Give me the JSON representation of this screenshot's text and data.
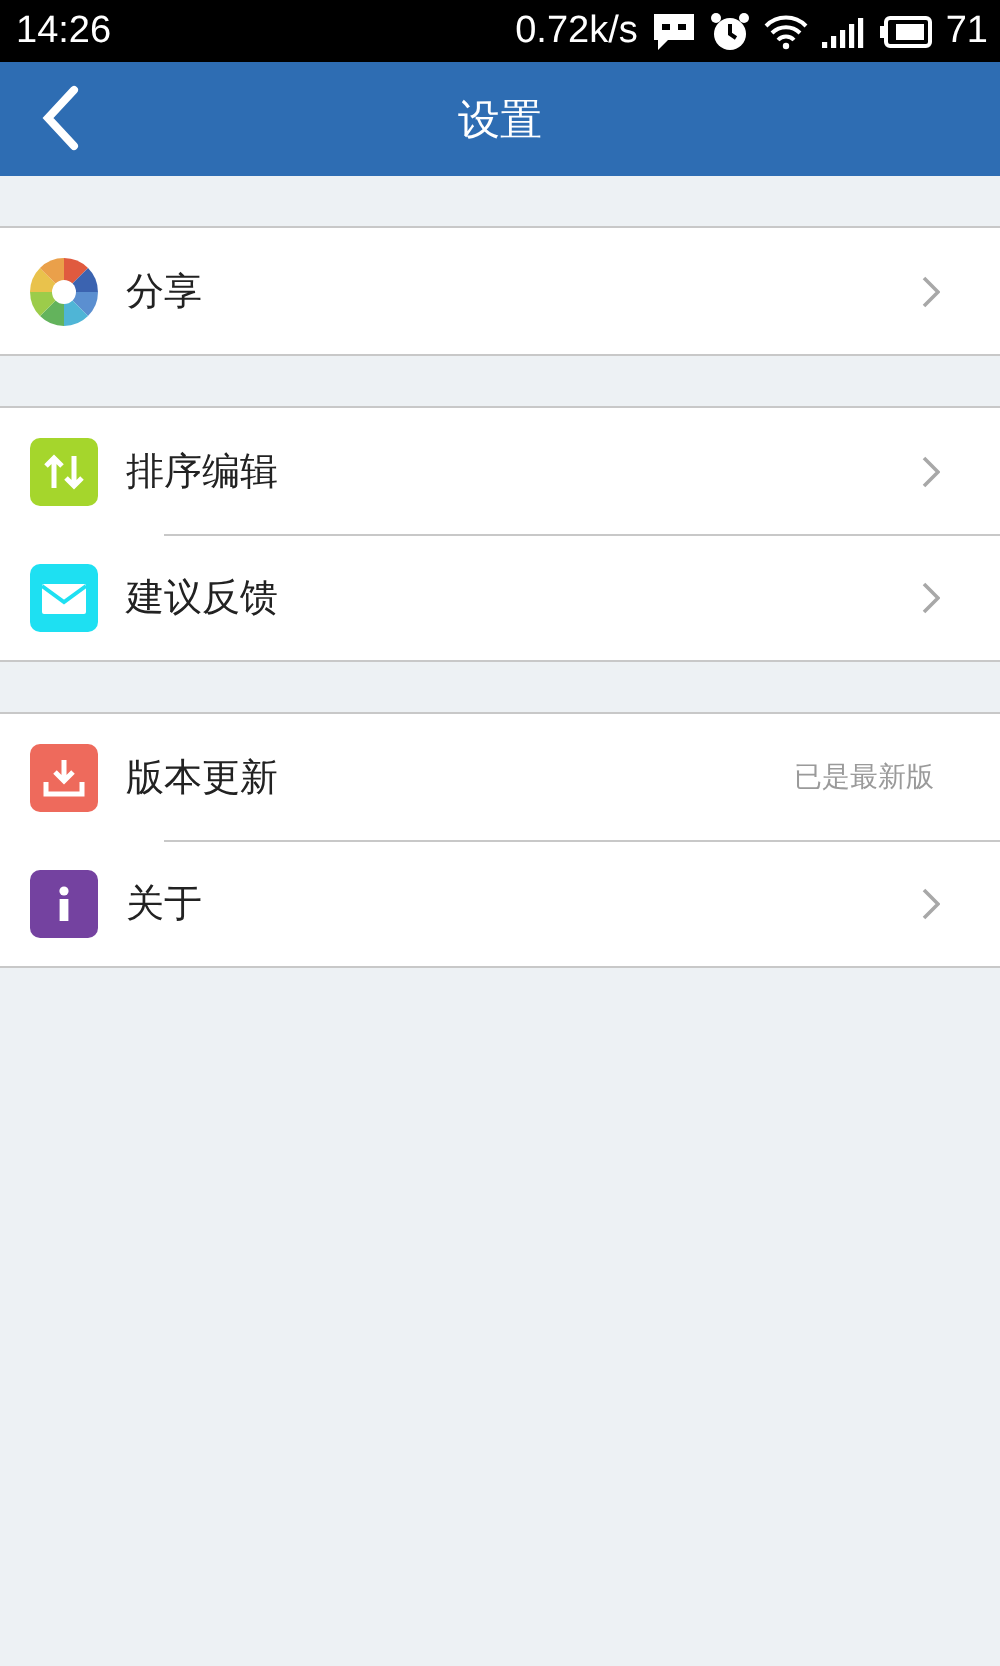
{
  "status_bar": {
    "time": "14:26",
    "speed": "0.72k/s",
    "battery": "71"
  },
  "header": {
    "title": "设置"
  },
  "groups": [
    {
      "items": [
        {
          "kind": "share",
          "label": "分享",
          "chevron": true
        }
      ]
    },
    {
      "items": [
        {
          "kind": "sort",
          "label": "排序编辑",
          "chevron": true
        },
        {
          "kind": "feedback",
          "label": "建议反馈",
          "chevron": true
        }
      ]
    },
    {
      "items": [
        {
          "kind": "update",
          "label": "版本更新",
          "value": "已是最新版",
          "chevron": false
        },
        {
          "kind": "about",
          "label": "关于",
          "chevron": true
        }
      ]
    }
  ]
}
